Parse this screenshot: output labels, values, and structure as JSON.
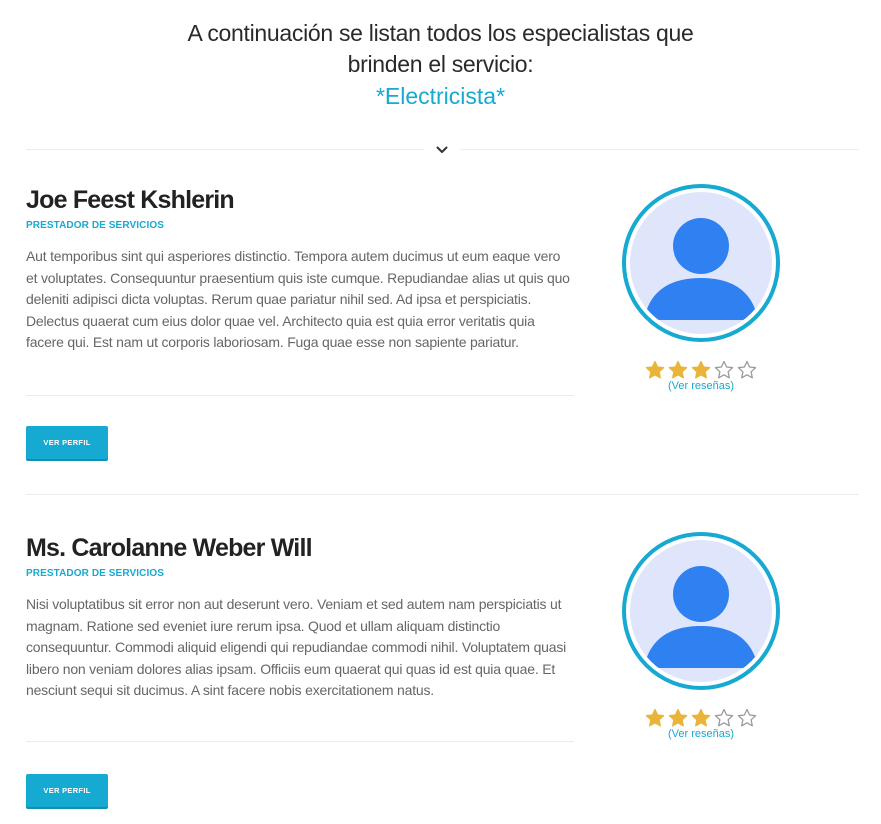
{
  "header": {
    "intro": "A continuación se listan todos los especialistas que brinden el servicio:",
    "service": "*Electricista*"
  },
  "icons": {
    "divider": "chevron-down-icon",
    "avatar": "user-avatar-icon",
    "star": "star-icon"
  },
  "colors": {
    "accent": "#16a9d1",
    "star": "#e8b53a",
    "avatar_bg": "#dfe6fb",
    "avatar_fg": "#2f80f0"
  },
  "specialists": [
    {
      "name": "Joe Feest Kshlerin",
      "role": "PRESTADOR DE SERVICIOS",
      "description": "Aut temporibus sint qui asperiores distinctio. Tempora autem ducimus ut eum eaque vero et voluptates. Consequuntur praesentium quis iste cumque. Repudiandae alias ut quis quo deleniti adipisci dicta voluptas. Rerum quae pariatur nihil sed. Ad ipsa et perspiciatis. Delectus quaerat cum eius dolor quae vel. Architecto quia est quia error veritatis quia facere qui. Est nam ut corporis laboriosam. Fuga quae esse non sapiente pariatur.",
      "button": "VER PERFIL",
      "rating": 2.5,
      "rating_max": 5,
      "reviews_link": "(Ver reseñas)"
    },
    {
      "name": "Ms. Carolanne Weber Will",
      "role": "PRESTADOR DE SERVICIOS",
      "description": "Nisi voluptatibus sit error non aut deserunt vero. Veniam et sed autem nam perspiciatis ut magnam. Ratione sed eveniet iure rerum ipsa. Quod et ullam aliquam distinctio consequuntur. Commodi aliquid eligendi qui repudiandae commodi nihil. Voluptatem quasi libero non veniam dolores alias ipsam. Officiis eum quaerat qui quas id est quia quae. Et nesciunt sequi sit ducimus. A sint facere nobis exercitationem natus.",
      "button": "VER PERFIL",
      "rating": 2.5,
      "rating_max": 5,
      "reviews_link": "(Ver reseñas)"
    }
  ]
}
